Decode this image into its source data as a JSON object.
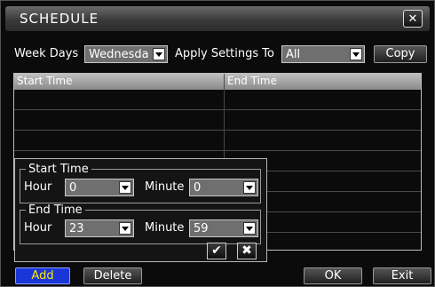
{
  "window": {
    "title": "SCHEDULE",
    "close_icon": "close-icon"
  },
  "toolbar": {
    "week_days_label": "Week Days",
    "week_days_value": "Wednesda",
    "apply_label": "Apply Settings To",
    "apply_value": "All",
    "copy_label": "Copy"
  },
  "table": {
    "columns": [
      "Start Time",
      "End Time"
    ],
    "rows": []
  },
  "popup": {
    "start_group": "Start Time",
    "end_group": "End Time",
    "hour_label": "Hour",
    "minute_label": "Minute",
    "start_hour": "0",
    "start_minute": "0",
    "end_hour": "23",
    "end_minute": "59",
    "confirm_icon": "check-icon",
    "cancel_icon": "x-icon"
  },
  "footer": {
    "add_label": "Add",
    "delete_label": "Delete",
    "ok_label": "OK",
    "exit_label": "Exit"
  },
  "colors": {
    "add_button": "#1a36d8",
    "background": "#0b0b0b",
    "title_bar": "#4a4a4a"
  }
}
